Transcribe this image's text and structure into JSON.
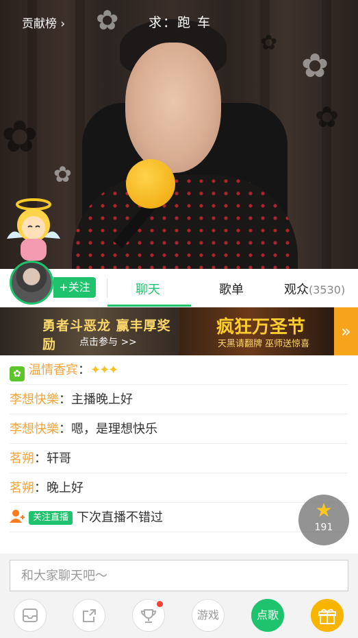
{
  "video": {
    "contrib_label": "贡献榜",
    "request_text": "求：跑 车"
  },
  "tabs": {
    "follow_label": "+关注",
    "chat": "聊天",
    "playlist": "歌单",
    "audience": "观众",
    "audience_count": "(3530)"
  },
  "banner": {
    "left_title": "勇者斗恶龙 赢丰厚奖励",
    "left_sub": "点击参与 >>",
    "right_title": "疯狂万圣节",
    "right_sub": "天黑请翻牌 巫师送惊喜",
    "arrow": "»"
  },
  "chat": {
    "messages": [
      {
        "user": "温情香宾",
        "sep": "：",
        "text": "",
        "badges": "✦✦✦"
      },
      {
        "user": "李想快樂",
        "sep": "：",
        "text": "主播晚上好"
      },
      {
        "user": "李想快樂",
        "sep": "：",
        "text": "嗯，是理想快乐"
      },
      {
        "user": "茗朔",
        "sep": "：",
        "text": "轩哥"
      },
      {
        "user": "茗朔",
        "sep": "：",
        "text": "晚上好"
      }
    ],
    "system": {
      "badge": "关注直播",
      "text": "下次直播不错过"
    }
  },
  "star": {
    "count": "191"
  },
  "input": {
    "placeholder": "和大家聊天吧～"
  },
  "toolbar": {
    "game": "游戏",
    "song": "点歌"
  },
  "colors": {
    "accent": "#1fc36d",
    "username": "#f0a43a",
    "gift": "#f7b500"
  }
}
